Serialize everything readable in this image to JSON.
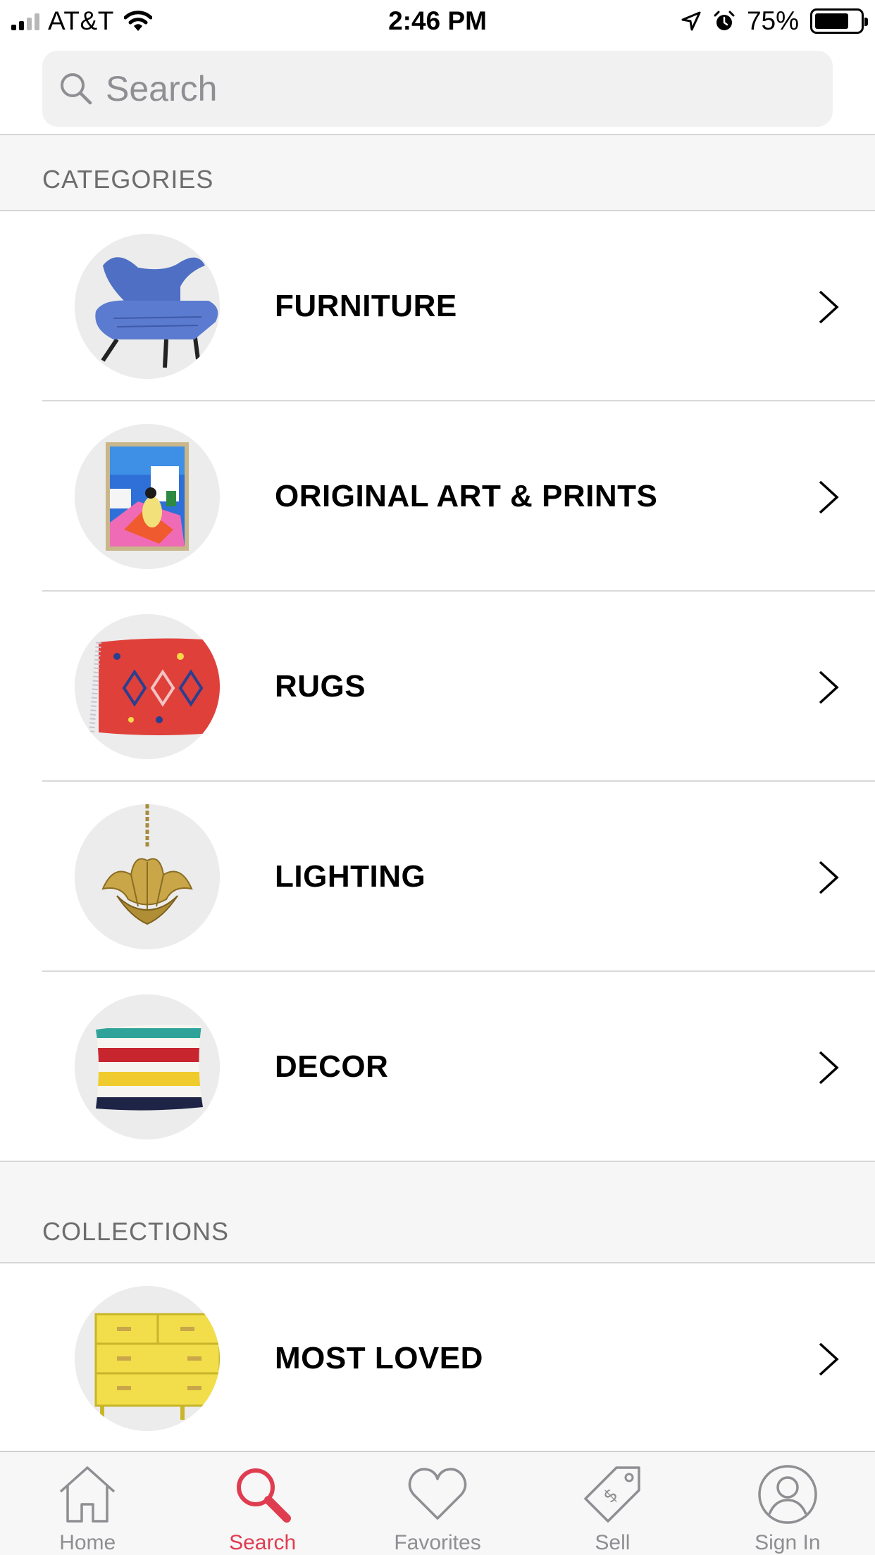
{
  "status_bar": {
    "carrier": "AT&T",
    "time": "2:46 PM",
    "battery": "75%",
    "battery_level": 0.75,
    "icons": [
      "cell-signal-icon",
      "wifi-icon",
      "location-arrow-icon",
      "alarm-icon",
      "battery-icon"
    ]
  },
  "search": {
    "placeholder": "Search",
    "icon": "search-icon"
  },
  "categories": {
    "header": "CATEGORIES",
    "items": [
      {
        "label": "FURNITURE",
        "image": "blue-chair"
      },
      {
        "label": "ORIGINAL ART & PRINTS",
        "image": "framed-painting"
      },
      {
        "label": "RUGS",
        "image": "red-rug"
      },
      {
        "label": "LIGHTING",
        "image": "brass-lotus-pendant"
      },
      {
        "label": "DECOR",
        "image": "striped-pillow"
      }
    ]
  },
  "collections": {
    "header": "COLLECTIONS",
    "items": [
      {
        "label": "MOST LOVED",
        "image": "yellow-dresser"
      }
    ]
  },
  "tab_bar": {
    "active": "Search",
    "active_color": "#e03c50",
    "inactive_color": "#8e8e93",
    "items": [
      {
        "label": "Home",
        "icon": "home-icon"
      },
      {
        "label": "Search",
        "icon": "search-icon"
      },
      {
        "label": "Favorites",
        "icon": "heart-icon"
      },
      {
        "label": "Sell",
        "icon": "price-tag-icon"
      },
      {
        "label": "Sign In",
        "icon": "user-icon"
      }
    ]
  }
}
